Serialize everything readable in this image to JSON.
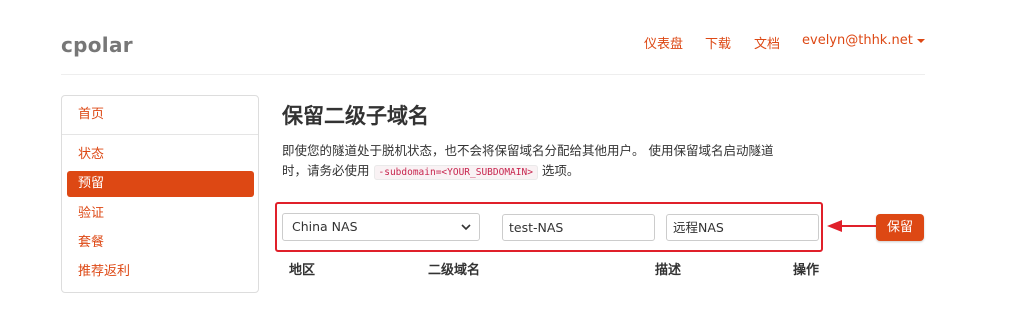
{
  "brand": "cpolar",
  "topnav": {
    "dashboard": "仪表盘",
    "download": "下载",
    "docs": "文档",
    "user": "evelyn@thhk.net"
  },
  "sidebar": {
    "items": [
      {
        "label": "首页",
        "active": false
      },
      {
        "label": "状态",
        "active": false
      },
      {
        "label": "预留",
        "active": true
      },
      {
        "label": "验证",
        "active": false
      },
      {
        "label": "套餐",
        "active": false
      },
      {
        "label": "推荐返利",
        "active": false
      }
    ]
  },
  "main": {
    "title": "保留二级子域名",
    "desc_line1": "即使您的隧道处于脱机状态，也不会将保留域名分配给其他用户。 使用保留域名启动隧道",
    "desc_line2_pre": "时，请务必使用",
    "desc_code": "-subdomain=<YOUR_SUBDOMAIN>",
    "desc_line2_post": "选项。"
  },
  "form": {
    "region_value": "China NAS",
    "subdomain_value": "test-NAS",
    "description_value": "远程NAS",
    "reserve_button": "保留"
  },
  "table_headers": {
    "region": "地区",
    "subdomain": "二级域名",
    "description": "描述",
    "action": "操作"
  },
  "colors": {
    "accent": "#dd4814",
    "annotation_red": "#e0202a"
  },
  "icons": {
    "dropdown_caret": "caret-down-icon",
    "select_chevron": "chevron-down-icon",
    "annotation_arrow": "arrow-left-icon"
  }
}
